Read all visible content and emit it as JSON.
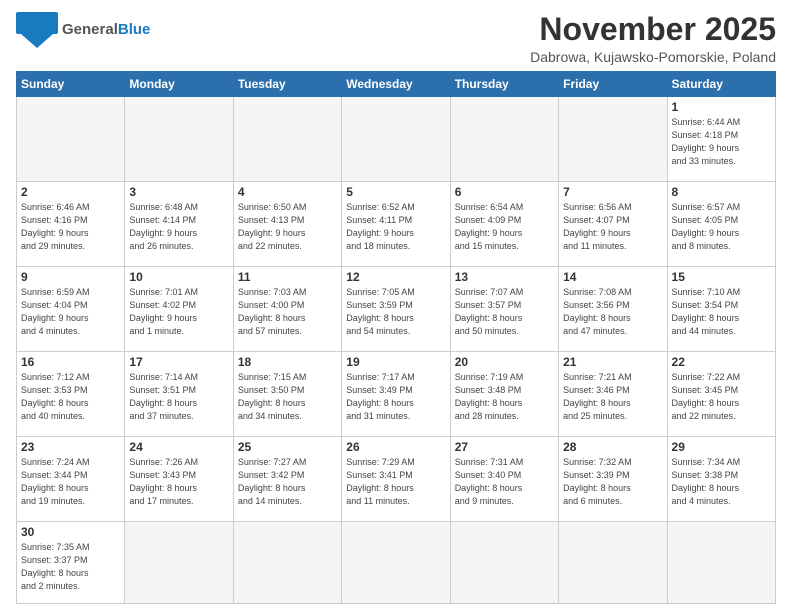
{
  "header": {
    "logo_general": "General",
    "logo_blue": "Blue",
    "title": "November 2025",
    "subtitle": "Dabrowa, Kujawsko-Pomorskie, Poland"
  },
  "days_of_week": [
    "Sunday",
    "Monday",
    "Tuesday",
    "Wednesday",
    "Thursday",
    "Friday",
    "Saturday"
  ],
  "weeks": [
    [
      {
        "num": "",
        "info": ""
      },
      {
        "num": "",
        "info": ""
      },
      {
        "num": "",
        "info": ""
      },
      {
        "num": "",
        "info": ""
      },
      {
        "num": "",
        "info": ""
      },
      {
        "num": "",
        "info": ""
      },
      {
        "num": "1",
        "info": "Sunrise: 6:44 AM\nSunset: 4:18 PM\nDaylight: 9 hours\nand 33 minutes."
      }
    ],
    [
      {
        "num": "2",
        "info": "Sunrise: 6:46 AM\nSunset: 4:16 PM\nDaylight: 9 hours\nand 29 minutes."
      },
      {
        "num": "3",
        "info": "Sunrise: 6:48 AM\nSunset: 4:14 PM\nDaylight: 9 hours\nand 26 minutes."
      },
      {
        "num": "4",
        "info": "Sunrise: 6:50 AM\nSunset: 4:13 PM\nDaylight: 9 hours\nand 22 minutes."
      },
      {
        "num": "5",
        "info": "Sunrise: 6:52 AM\nSunset: 4:11 PM\nDaylight: 9 hours\nand 18 minutes."
      },
      {
        "num": "6",
        "info": "Sunrise: 6:54 AM\nSunset: 4:09 PM\nDaylight: 9 hours\nand 15 minutes."
      },
      {
        "num": "7",
        "info": "Sunrise: 6:56 AM\nSunset: 4:07 PM\nDaylight: 9 hours\nand 11 minutes."
      },
      {
        "num": "8",
        "info": "Sunrise: 6:57 AM\nSunset: 4:05 PM\nDaylight: 9 hours\nand 8 minutes."
      }
    ],
    [
      {
        "num": "9",
        "info": "Sunrise: 6:59 AM\nSunset: 4:04 PM\nDaylight: 9 hours\nand 4 minutes."
      },
      {
        "num": "10",
        "info": "Sunrise: 7:01 AM\nSunset: 4:02 PM\nDaylight: 9 hours\nand 1 minute."
      },
      {
        "num": "11",
        "info": "Sunrise: 7:03 AM\nSunset: 4:00 PM\nDaylight: 8 hours\nand 57 minutes."
      },
      {
        "num": "12",
        "info": "Sunrise: 7:05 AM\nSunset: 3:59 PM\nDaylight: 8 hours\nand 54 minutes."
      },
      {
        "num": "13",
        "info": "Sunrise: 7:07 AM\nSunset: 3:57 PM\nDaylight: 8 hours\nand 50 minutes."
      },
      {
        "num": "14",
        "info": "Sunrise: 7:08 AM\nSunset: 3:56 PM\nDaylight: 8 hours\nand 47 minutes."
      },
      {
        "num": "15",
        "info": "Sunrise: 7:10 AM\nSunset: 3:54 PM\nDaylight: 8 hours\nand 44 minutes."
      }
    ],
    [
      {
        "num": "16",
        "info": "Sunrise: 7:12 AM\nSunset: 3:53 PM\nDaylight: 8 hours\nand 40 minutes."
      },
      {
        "num": "17",
        "info": "Sunrise: 7:14 AM\nSunset: 3:51 PM\nDaylight: 8 hours\nand 37 minutes."
      },
      {
        "num": "18",
        "info": "Sunrise: 7:15 AM\nSunset: 3:50 PM\nDaylight: 8 hours\nand 34 minutes."
      },
      {
        "num": "19",
        "info": "Sunrise: 7:17 AM\nSunset: 3:49 PM\nDaylight: 8 hours\nand 31 minutes."
      },
      {
        "num": "20",
        "info": "Sunrise: 7:19 AM\nSunset: 3:48 PM\nDaylight: 8 hours\nand 28 minutes."
      },
      {
        "num": "21",
        "info": "Sunrise: 7:21 AM\nSunset: 3:46 PM\nDaylight: 8 hours\nand 25 minutes."
      },
      {
        "num": "22",
        "info": "Sunrise: 7:22 AM\nSunset: 3:45 PM\nDaylight: 8 hours\nand 22 minutes."
      }
    ],
    [
      {
        "num": "23",
        "info": "Sunrise: 7:24 AM\nSunset: 3:44 PM\nDaylight: 8 hours\nand 19 minutes."
      },
      {
        "num": "24",
        "info": "Sunrise: 7:26 AM\nSunset: 3:43 PM\nDaylight: 8 hours\nand 17 minutes."
      },
      {
        "num": "25",
        "info": "Sunrise: 7:27 AM\nSunset: 3:42 PM\nDaylight: 8 hours\nand 14 minutes."
      },
      {
        "num": "26",
        "info": "Sunrise: 7:29 AM\nSunset: 3:41 PM\nDaylight: 8 hours\nand 11 minutes."
      },
      {
        "num": "27",
        "info": "Sunrise: 7:31 AM\nSunset: 3:40 PM\nDaylight: 8 hours\nand 9 minutes."
      },
      {
        "num": "28",
        "info": "Sunrise: 7:32 AM\nSunset: 3:39 PM\nDaylight: 8 hours\nand 6 minutes."
      },
      {
        "num": "29",
        "info": "Sunrise: 7:34 AM\nSunset: 3:38 PM\nDaylight: 8 hours\nand 4 minutes."
      }
    ],
    [
      {
        "num": "30",
        "info": "Sunrise: 7:35 AM\nSunset: 3:37 PM\nDaylight: 8 hours\nand 2 minutes."
      },
      {
        "num": "",
        "info": ""
      },
      {
        "num": "",
        "info": ""
      },
      {
        "num": "",
        "info": ""
      },
      {
        "num": "",
        "info": ""
      },
      {
        "num": "",
        "info": ""
      },
      {
        "num": "",
        "info": ""
      }
    ]
  ]
}
